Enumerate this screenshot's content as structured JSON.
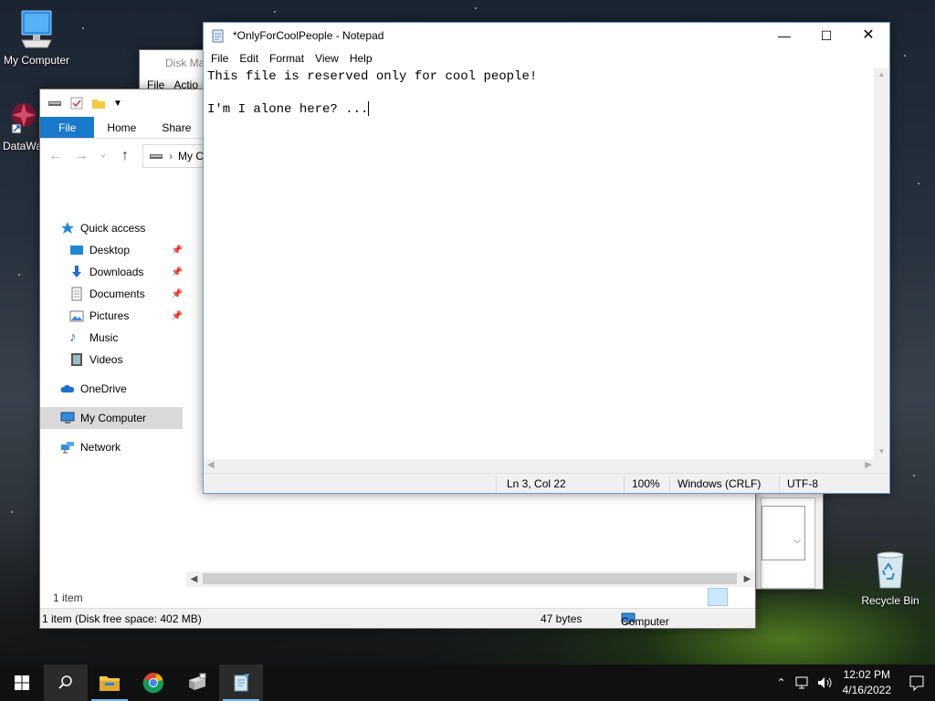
{
  "desktop": {
    "icons": [
      {
        "label": "My Computer"
      },
      {
        "label": "DataWa"
      },
      {
        "label": "Recycle Bin"
      }
    ]
  },
  "disk_management": {
    "title": "Disk Ma",
    "menu": [
      "File",
      "Actio"
    ]
  },
  "explorer": {
    "ribbon_tabs": [
      "File",
      "Home",
      "Share"
    ],
    "address": "My Co",
    "nav": {
      "quick_access": "Quick access",
      "pinned": [
        "Desktop",
        "Downloads",
        "Documents",
        "Pictures"
      ],
      "unpinned": [
        "Music",
        "Videos"
      ],
      "onedrive": "OneDrive",
      "my_computer": "My Computer",
      "network": "Network"
    },
    "item_count": "1 item",
    "status": {
      "left": "1 item (Disk free space: 402 MB)",
      "size": "47 bytes",
      "location": "Computer"
    }
  },
  "notepad": {
    "title": "*OnlyForCoolPeople - Notepad",
    "menu": [
      "File",
      "Edit",
      "Format",
      "View",
      "Help"
    ],
    "lines": [
      "This file is reserved only for cool people!",
      "",
      "I'm I alone here? ..."
    ],
    "status": {
      "position": "Ln 3, Col 22",
      "zoom": "100%",
      "line_ending": "Windows (CRLF)",
      "encoding": "UTF-8"
    }
  },
  "taskbar": {
    "pinned": [
      "start-icon",
      "search-icon",
      "file-explorer-icon",
      "chrome-icon",
      "computer-management-icon",
      "notepad-icon"
    ],
    "clock": {
      "time": "12:02 PM",
      "date": "4/16/2022"
    }
  }
}
